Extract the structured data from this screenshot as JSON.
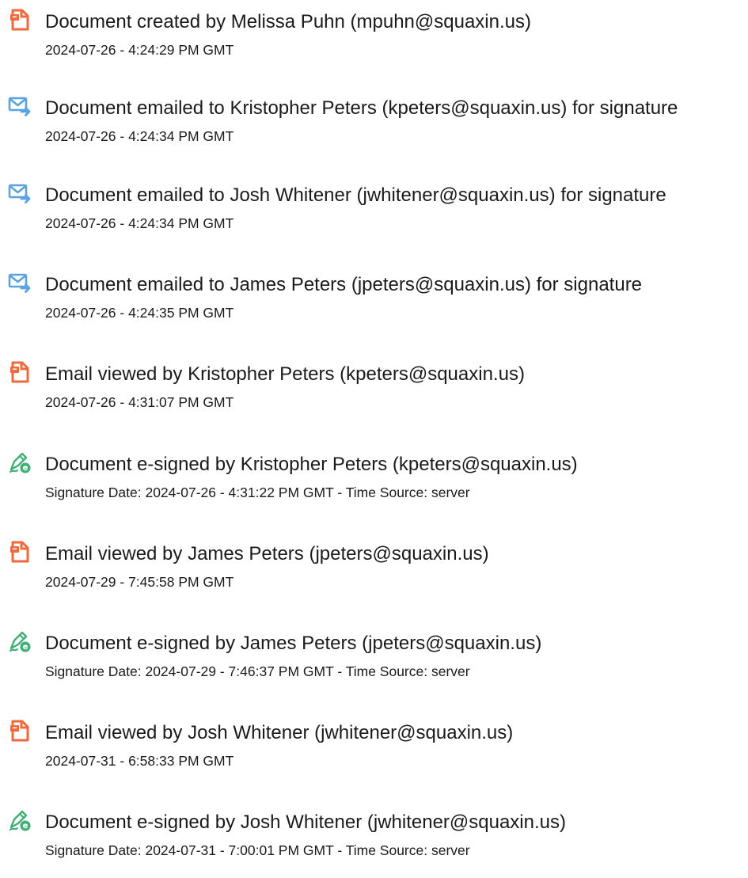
{
  "icon_colors": {
    "document": "#ee6a3c",
    "email": "#5aa3e0",
    "esign": "#3fae73"
  },
  "events": [
    {
      "icon": "document-icon",
      "title": "Document created by Melissa Puhn (mpuhn@squaxin.us)",
      "timestamp": "2024-07-26 - 4:24:29 PM GMT"
    },
    {
      "icon": "email-sent-icon",
      "title": "Document emailed to Kristopher Peters (kpeters@squaxin.us) for signature",
      "timestamp": "2024-07-26 - 4:24:34 PM GMT"
    },
    {
      "icon": "email-sent-icon",
      "title": "Document emailed to Josh Whitener (jwhitener@squaxin.us) for signature",
      "timestamp": "2024-07-26 - 4:24:34 PM GMT"
    },
    {
      "icon": "email-sent-icon",
      "title": "Document emailed to James Peters (jpeters@squaxin.us) for signature",
      "timestamp": "2024-07-26 - 4:24:35 PM GMT"
    },
    {
      "icon": "document-icon",
      "title": "Email viewed by Kristopher Peters (kpeters@squaxin.us)",
      "timestamp": "2024-07-26 - 4:31:07 PM GMT"
    },
    {
      "icon": "esign-icon",
      "title": "Document e-signed by Kristopher Peters (kpeters@squaxin.us)",
      "timestamp": "Signature Date: 2024-07-26 - 4:31:22 PM GMT - Time Source: server"
    },
    {
      "icon": "document-icon",
      "title": "Email viewed by James Peters (jpeters@squaxin.us)",
      "timestamp": "2024-07-29 - 7:45:58 PM GMT"
    },
    {
      "icon": "esign-icon",
      "title": "Document e-signed by James Peters (jpeters@squaxin.us)",
      "timestamp": "Signature Date: 2024-07-29 - 7:46:37 PM GMT - Time Source: server"
    },
    {
      "icon": "document-icon",
      "title": "Email viewed by Josh Whitener (jwhitener@squaxin.us)",
      "timestamp": "2024-07-31 - 6:58:33 PM GMT"
    },
    {
      "icon": "esign-icon",
      "title": "Document e-signed by Josh Whitener (jwhitener@squaxin.us)",
      "timestamp": "Signature Date: 2024-07-31 - 7:00:01 PM GMT - Time Source: server"
    }
  ]
}
